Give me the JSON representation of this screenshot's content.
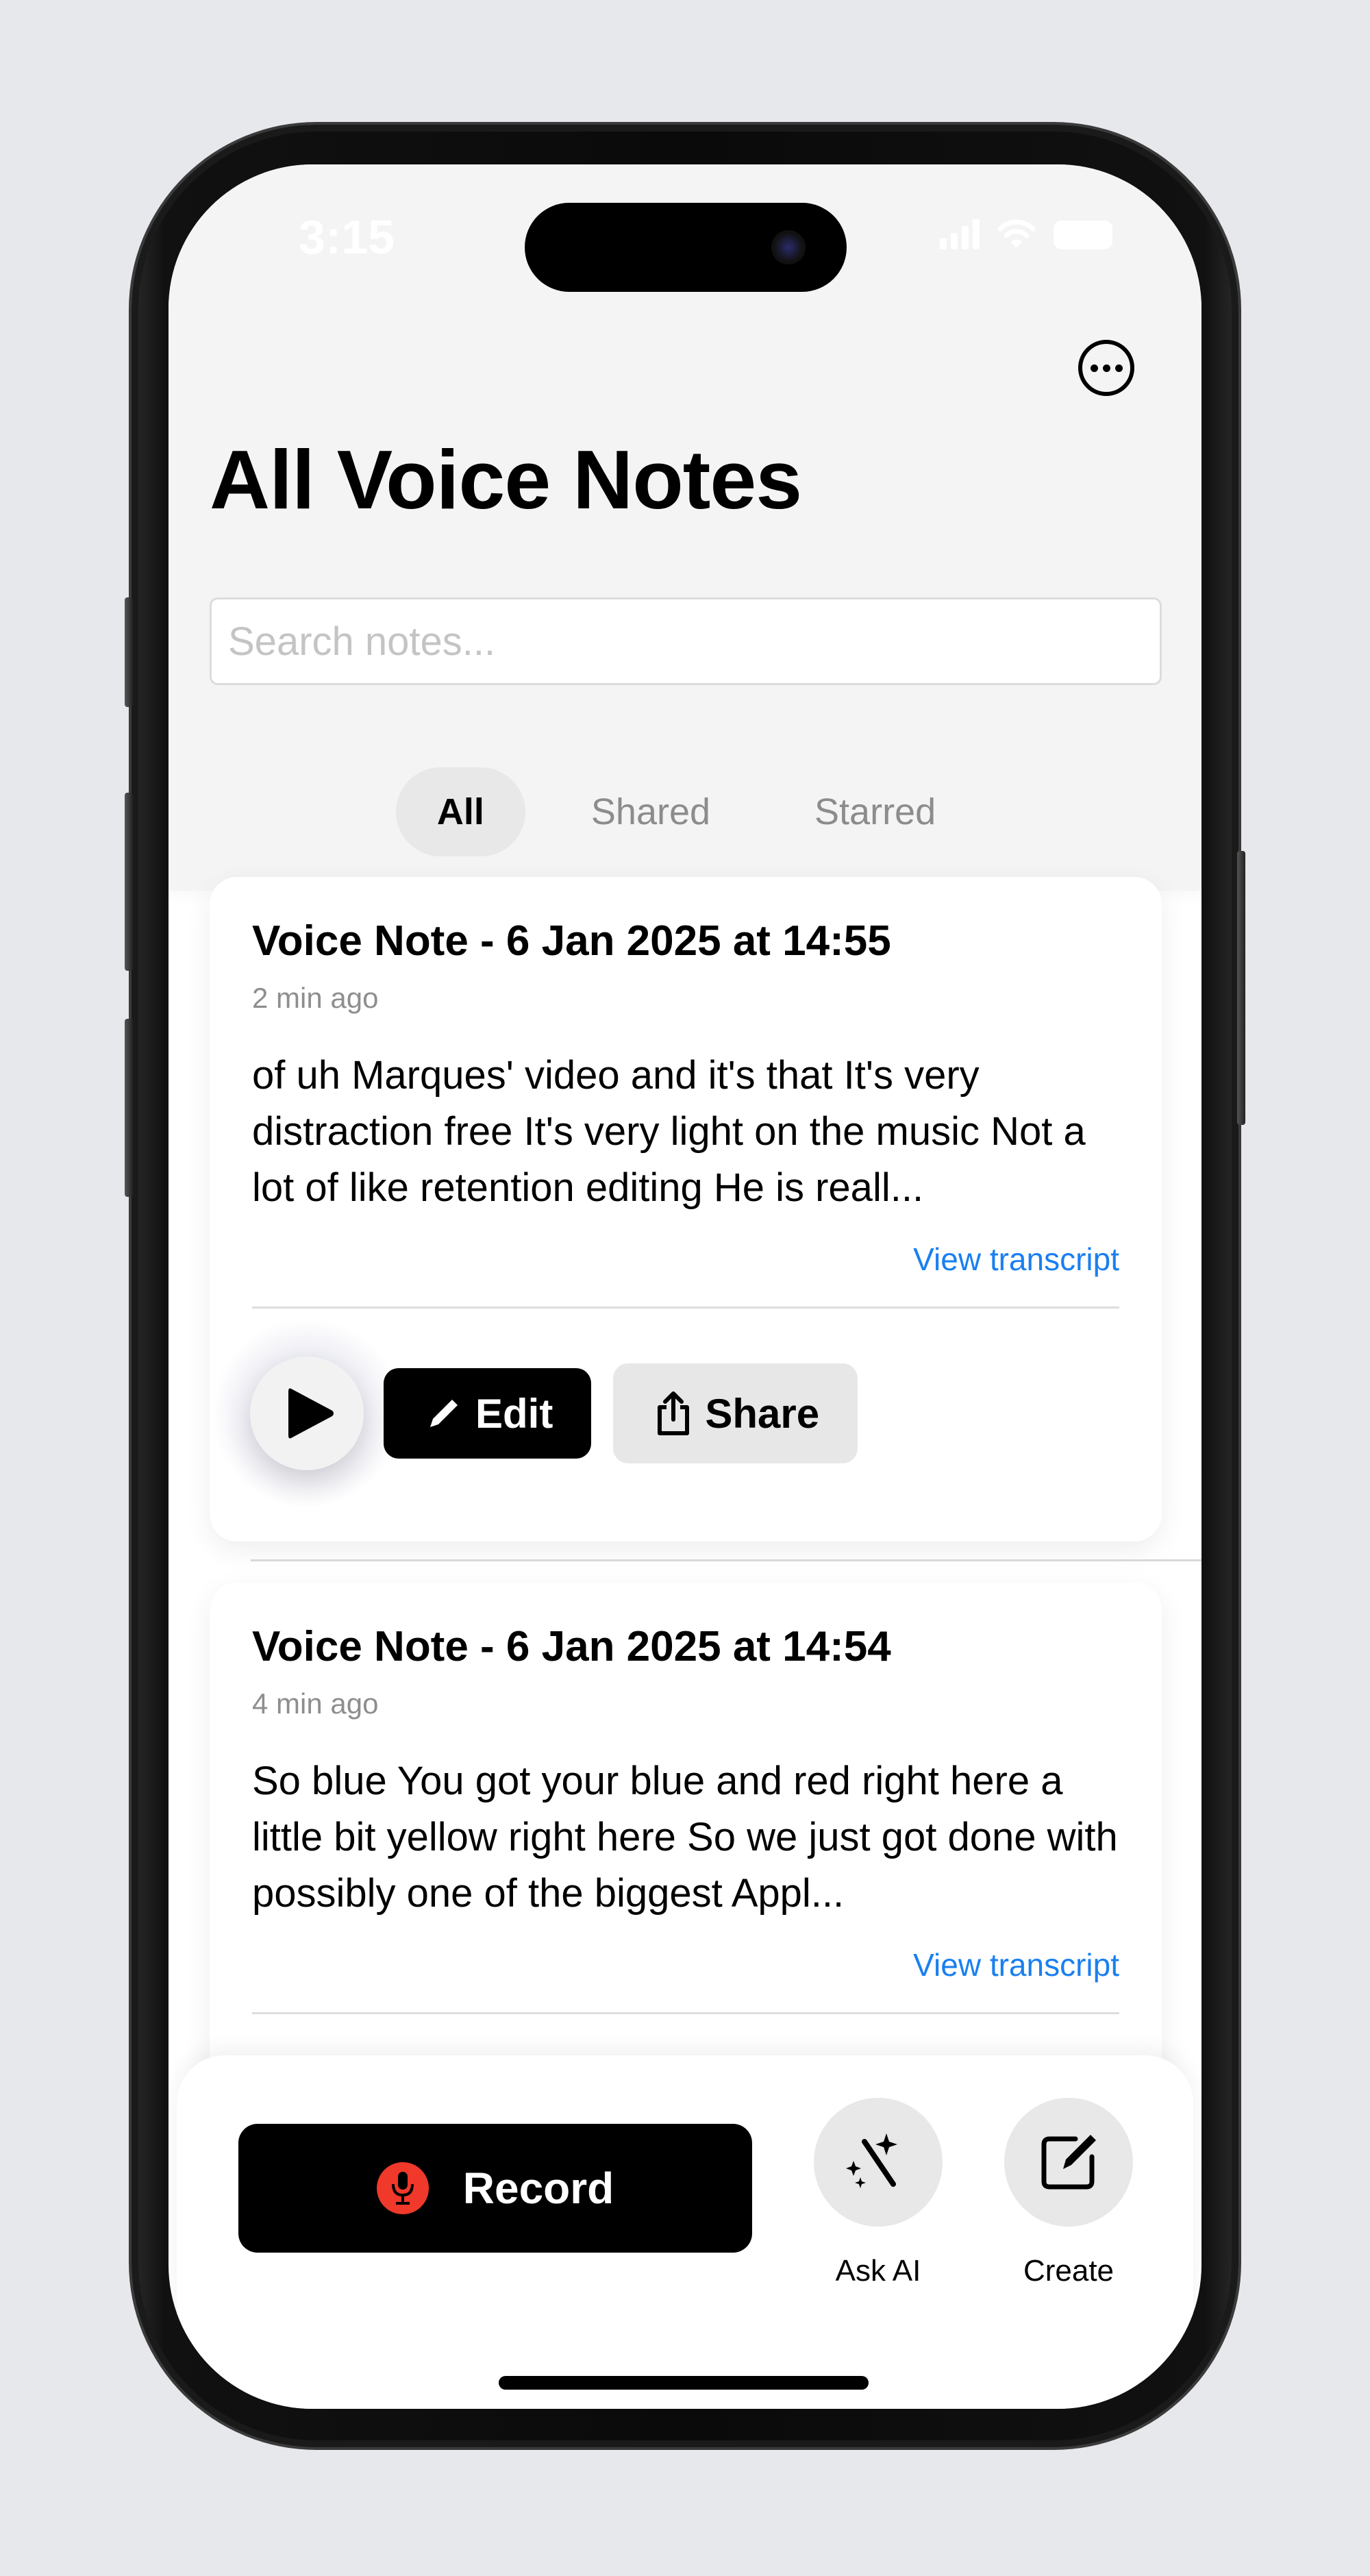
{
  "status_bar": {
    "time": "3:15"
  },
  "header": {
    "title": "All Voice Notes",
    "search_placeholder": "Search notes...",
    "more_label": "More options"
  },
  "tabs": [
    {
      "label": "All",
      "active": true
    },
    {
      "label": "Shared",
      "active": false
    },
    {
      "label": "Starred",
      "active": false
    }
  ],
  "notes": [
    {
      "title": "Voice Note - 6 Jan 2025 at 14:55",
      "time_ago": "2 min ago",
      "excerpt": "of uh Marques' video and it's that It's very distraction free It's very light on the music Not a lot of like retention editing He is reall...",
      "link": "View transcript",
      "actions": {
        "edit": "Edit",
        "share": "Share"
      }
    },
    {
      "title": "Voice Note - 6 Jan 2025 at 14:54",
      "time_ago": "4 min ago",
      "excerpt": "So blue You got your blue and red right here a little bit yellow right here So we just got done with possibly one of the biggest Appl...",
      "link": "View transcript"
    }
  ],
  "bottom_bar": {
    "record": "Record",
    "ask_ai": "Ask AI",
    "create": "Create"
  },
  "colors": {
    "accent_link": "#1a7ff0",
    "record_red": "#f0392b"
  }
}
